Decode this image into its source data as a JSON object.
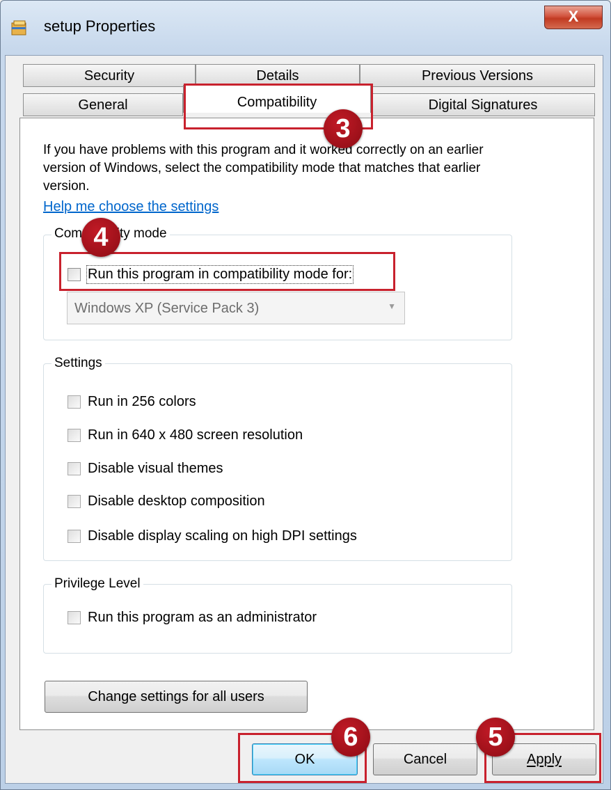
{
  "window": {
    "title": "setup Properties",
    "close_label": "X"
  },
  "tabs": {
    "row1": [
      "Security",
      "Details",
      "Previous Versions"
    ],
    "row2": [
      "General",
      "Compatibility",
      "Digital Signatures"
    ],
    "active": "Compatibility"
  },
  "main": {
    "description": "If you have problems with this program and it worked correctly on an earlier version of Windows, select the compatibility mode that matches that earlier version.",
    "help_link": "Help me choose the settings"
  },
  "compatibility_mode": {
    "title": "Compatibility mode",
    "checkbox_label": "Run this program in compatibility mode for:",
    "checked": false,
    "os_select_value": "Windows XP (Service Pack 3)"
  },
  "settings": {
    "title": "Settings",
    "items": [
      {
        "label": "Run in 256 colors",
        "checked": false
      },
      {
        "label": "Run in 640 x 480 screen resolution",
        "checked": false
      },
      {
        "label": "Disable visual themes",
        "checked": false
      },
      {
        "label": "Disable desktop composition",
        "checked": false
      },
      {
        "label": "Disable display scaling on high DPI settings",
        "checked": false
      }
    ]
  },
  "privilege": {
    "title": "Privilege Level",
    "checkbox_label": "Run this program as an administrator",
    "checked": false
  },
  "buttons": {
    "change_all_users": "Change settings for all users",
    "ok": "OK",
    "cancel": "Cancel",
    "apply": "Apply"
  },
  "annotations": {
    "markers": [
      "3",
      "4",
      "5",
      "6"
    ],
    "color": "#c8212d"
  },
  "colors": {
    "link": "#0066cc",
    "close_button": "#c13a22",
    "default_button_border": "#3c7fb1"
  }
}
